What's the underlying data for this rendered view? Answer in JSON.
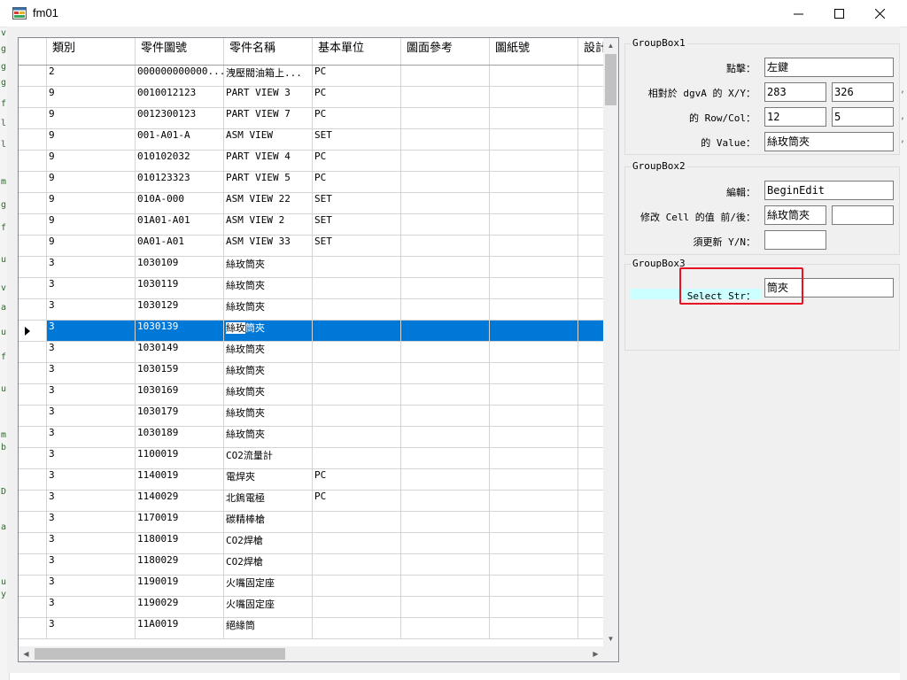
{
  "window": {
    "title": "fm01",
    "minimize_glyph": "—",
    "maximize_glyph": "☐",
    "close_glyph": "✕"
  },
  "grid": {
    "columns": [
      "",
      "類別",
      "零件圖號",
      "零件名稱",
      "基本單位",
      "圖面參考",
      "圖紙號",
      "設計者"
    ],
    "rows": [
      [
        "2",
        "000000000000...",
        "洩壓閥油箱上...",
        "PC"
      ],
      [
        "9",
        "0010012123",
        "PART VIEW 3",
        "PC"
      ],
      [
        "9",
        "0012300123",
        "PART VIEW 7",
        "PC"
      ],
      [
        "9",
        "001-A01-A",
        "ASM VIEW",
        "SET"
      ],
      [
        "9",
        "010102032",
        "PART VIEW 4",
        "PC"
      ],
      [
        "9",
        "010123323",
        "PART VIEW 5",
        "PC"
      ],
      [
        "9",
        "010A-000",
        "ASM VIEW 22",
        "SET"
      ],
      [
        "9",
        "01A01-A01",
        "ASM VIEW 2",
        "SET"
      ],
      [
        "9",
        "0A01-A01",
        "ASM VIEW 33",
        "SET"
      ],
      [
        "3",
        "1030109",
        "絲玫筒夾",
        ""
      ],
      [
        "3",
        "1030119",
        "絲玫筒夾",
        ""
      ],
      [
        "3",
        "1030129",
        "絲玫筒夾",
        ""
      ],
      [
        "3",
        "1030139",
        "絲玫筒夾",
        ""
      ],
      [
        "3",
        "1030149",
        "絲玫筒夾",
        ""
      ],
      [
        "3",
        "1030159",
        "絲玫筒夾",
        ""
      ],
      [
        "3",
        "1030169",
        "絲玫筒夾",
        ""
      ],
      [
        "3",
        "1030179",
        "絲玫筒夾",
        ""
      ],
      [
        "3",
        "1030189",
        "絲玫筒夾",
        ""
      ],
      [
        "3",
        "1100019",
        "CO2流量計",
        ""
      ],
      [
        "3",
        "1140019",
        "電焊夾",
        "PC"
      ],
      [
        "3",
        "1140029",
        "北鎢電極",
        "PC"
      ],
      [
        "3",
        "1170019",
        "碳精棒槍",
        ""
      ],
      [
        "3",
        "1180019",
        "CO2焊槍",
        ""
      ],
      [
        "3",
        "1180029",
        "CO2焊槍",
        ""
      ],
      [
        "3",
        "1190019",
        "火嘴固定座",
        ""
      ],
      [
        "3",
        "1190029",
        "火嘴固定座",
        ""
      ],
      [
        "3",
        "11A0019",
        "絕緣筒",
        ""
      ]
    ],
    "selected_row": 12,
    "selected_cell": {
      "unselected_part": "絲玫",
      "selected_part": "筒夾"
    },
    "scroll_glyphs": {
      "up": "▲",
      "down": "▼",
      "left": "◀",
      "right": "▶"
    }
  },
  "groupbox1": {
    "title": "GroupBox1",
    "click_label": "點擊：",
    "click_value": "左鍵",
    "xy_label": "相對於 dgvA 的 X/Y：",
    "x_value": "283",
    "y_value": "326",
    "rowcol_label": "的 Row/Col：",
    "row_value": "12",
    "col_value": "5",
    "value_label": "的 Value：",
    "value_value": "絲玫筒夾"
  },
  "groupbox2": {
    "title": "GroupBox2",
    "edit_label": "編輯：",
    "edit_value": "BeginEdit",
    "modify_label": "修改 Cell 的值 前/後：",
    "before_value": "絲玫筒夾",
    "after_value": "",
    "update_label": "須更新 Y/N：",
    "update_value": ""
  },
  "groupbox3": {
    "title": "GroupBox3",
    "select_label": "Select Str：",
    "select_value": "筒夾"
  },
  "colors": {
    "selection": "#0078d7",
    "highlight_label_bg": "#ccffff",
    "annotation_box": "#e81123"
  }
}
